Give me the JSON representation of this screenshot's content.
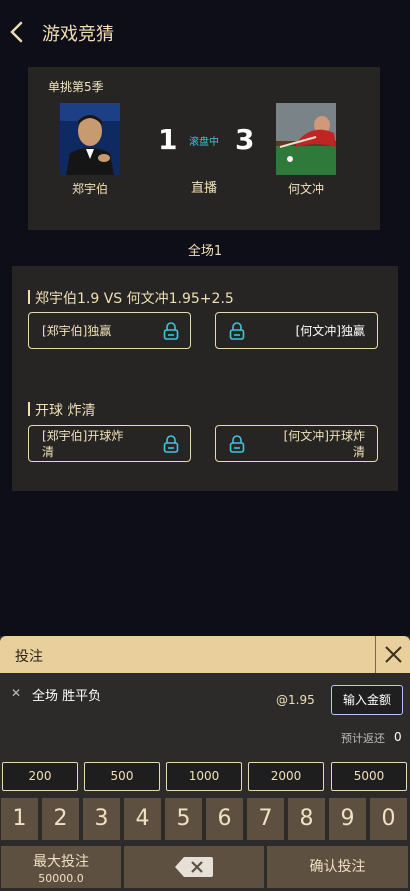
{
  "header": {
    "title": "游戏竞猜"
  },
  "match": {
    "league": "单挑第5季",
    "home": {
      "name": "郑宇伯",
      "score": "1"
    },
    "away": {
      "name": "何文冲",
      "score": "3"
    },
    "status": "滚盘中",
    "live_label": "直播"
  },
  "period_label": "全场1",
  "markets": [
    {
      "title": "郑宇伯1.9 VS 何文冲1.95+2.5",
      "options": [
        {
          "label": "[郑宇伯]独赢"
        },
        {
          "label": "[何文冲]独赢"
        }
      ]
    },
    {
      "title": "开球 炸清",
      "options": [
        {
          "line1": "[郑宇伯]开球炸",
          "line2": "清"
        },
        {
          "line1": "[何文冲]开球炸",
          "line2": "清"
        }
      ]
    }
  ],
  "bet_panel": {
    "title": "投注",
    "selection": "全场 胜平负",
    "odds": "@1.95",
    "amount_button": "输入金额",
    "return_label": "预计返还",
    "return_value": "0",
    "quick_amounts": [
      "200",
      "500",
      "1000",
      "2000",
      "5000"
    ],
    "keypad": [
      "1",
      "2",
      "3",
      "4",
      "5",
      "6",
      "7",
      "8",
      "9",
      "0"
    ],
    "max_bet_label": "最大投注",
    "max_bet_value": "50000.0",
    "confirm_label": "确认投注"
  },
  "colors": {
    "accent_gold": "#e9cf9c",
    "lock_blue": "#3bc7dc",
    "status_cyan": "#3bc7dc"
  },
  "icons": [
    "back-arrow-icon",
    "lock-icon",
    "close-icon",
    "backspace-icon"
  ]
}
